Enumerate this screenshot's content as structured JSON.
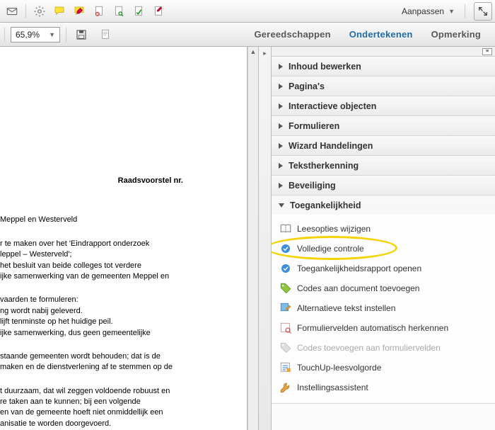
{
  "toolbar": {
    "customize_label": "Aanpassen"
  },
  "zoom": "65,9%",
  "tabs": {
    "tools": "Gereedschappen",
    "sign": "Ondertekenen",
    "comment": "Opmerking"
  },
  "document": {
    "heading": "Raadsvoorstel nr.",
    "line1": "Meppel en Westerveld",
    "para2a": "r te maken over het 'Eindrapport onderzoek",
    "para2b": "leppel – Westerveld';",
    "para2c": " het besluit van beide colleges tot verdere",
    "para2d": "ijke samenwerking van de gemeenten Meppel en",
    "para3a": "vaarden te formuleren:",
    "para3b": "ng wordt nabij geleverd.",
    "para3c": "lijft tenminste op het huidige peil.",
    "para3d": "ijke samenwerking, dus geen gemeentelijke",
    "para4a": "staande gemeenten wordt behouden; dat is de",
    "para4b": "maken en de dienstverlening af te stemmen op de",
    "para5a": "t duurzaam, dat wil zeggen voldoende robuust en",
    "para5b": "re taken aan te kunnen; bij een volgende",
    "para5c": "en van de gemeente hoeft niet onmiddellijk een",
    "para5d": "anisatie te worden doorgevoerd."
  },
  "panel": {
    "sections": {
      "content_edit": "Inhoud bewerken",
      "pages": "Pagina's",
      "interactive": "Interactieve objecten",
      "forms": "Formulieren",
      "wizard": "Wizard Handelingen",
      "ocr": "Tekstherkenning",
      "security": "Beveiliging",
      "accessibility": "Toegankelijkheid"
    },
    "accessibility_items": {
      "read_options": "Leesopties wijzigen",
      "full_check": "Volledige controle",
      "open_report": "Toegankelijkheidsrapport openen",
      "add_tags": "Codes aan document toevoegen",
      "alt_text": "Alternatieve tekst instellen",
      "form_fields": "Formuliervelden automatisch herkennen",
      "add_codes_form": "Codes toevoegen aan formuliervelden",
      "touchup": "TouchUp-leesvolgorde",
      "setup": "Instellingsassistent"
    }
  }
}
